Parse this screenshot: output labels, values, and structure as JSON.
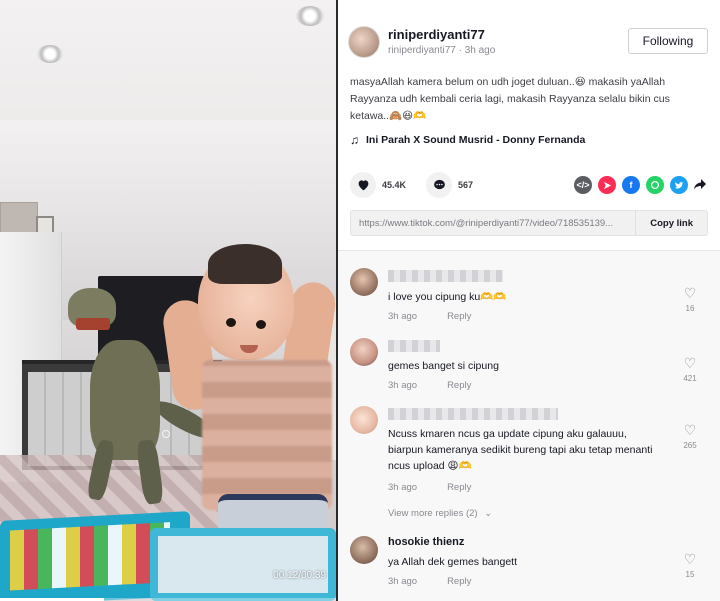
{
  "video": {
    "time_display": "00:12/00:39",
    "progress": 0.31
  },
  "post": {
    "author_name": "riniperdiyanti77",
    "author_sub": "riniperdiyanti77 · 3h ago",
    "follow_label": "Following",
    "caption": "masyaAllah kamera belum on udh joget duluan..😆 makasih yaAllah Rayyanza udh kembali ceria lagi, makasih Rayyanza selalu bikin cus ketawa..🙈😆🫶",
    "music_icon": "♫",
    "music_title": "Ini Parah X Sound Musrid - Donny Fernanda",
    "likes": "45.4K",
    "comments_count": "567",
    "link_url": "https://www.tiktok.com/@riniperdiyanti77/video/718535139...",
    "copy_link_label": "Copy link",
    "share_icons": [
      "embed-icon",
      "send-icon",
      "facebook-icon",
      "whatsapp-icon",
      "twitter-icon",
      "share-more-icon"
    ]
  },
  "comments": [
    {
      "name": "",
      "text": "i love you cipung ku🫶🫶",
      "time": "3h ago",
      "reply": "Reply",
      "likes": "16"
    },
    {
      "name": "",
      "text": "gemes banget si cipung",
      "time": "3h ago",
      "reply": "Reply",
      "likes": "421"
    },
    {
      "name": "",
      "text": "Ncuss kmaren ncus ga update cipung aku galauuu, biarpun kameranya sedikit bureng tapi aku tetap menanti ncus upload 😩🫶",
      "time": "3h ago",
      "reply": "Reply",
      "likes": "265"
    },
    {
      "name": "hosokie thienz",
      "text": "ya Allah dek gemes bangett",
      "time": "3h ago",
      "reply": "Reply",
      "likes": "15"
    }
  ],
  "view_more_replies": "View more replies (2)",
  "colors": {
    "accent": "#fe2c55",
    "facebook": "#1877f2",
    "whatsapp": "#25d366",
    "twitter": "#1da1f2"
  }
}
